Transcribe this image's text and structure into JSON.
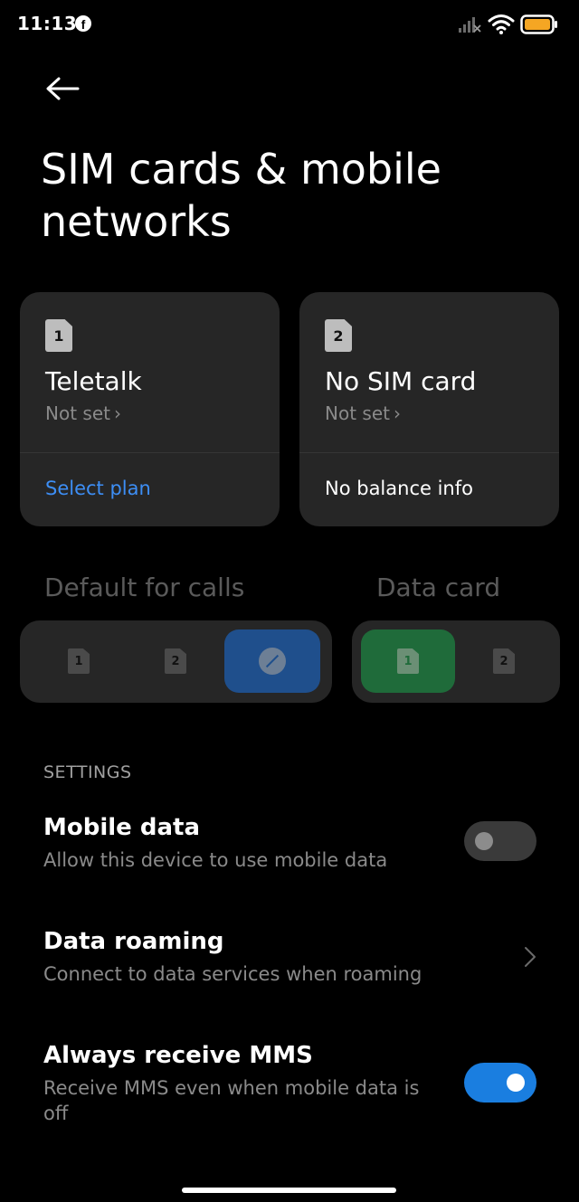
{
  "status_bar": {
    "time": "11:13",
    "notification_icon": "facebook-icon",
    "signal_icon": "cellular-signal-no-service-icon",
    "wifi_icon": "wifi-icon",
    "battery_icon": "battery-icon",
    "battery_color": "#f5a623"
  },
  "header": {
    "back_icon": "arrow-left-icon",
    "title": "SIM cards & mobile networks"
  },
  "sim_cards": [
    {
      "slot": "1",
      "name": "Teletalk",
      "status": "Not set",
      "action": "Select plan",
      "action_color": "#3d8ef5"
    },
    {
      "slot": "2",
      "name": "No SIM card",
      "status": "Not set",
      "action": "No balance info",
      "action_color": "#ffffff"
    }
  ],
  "defaults": {
    "calls_label": "Default for calls",
    "calls_options": [
      {
        "slot": "1",
        "selected": false
      },
      {
        "slot": "2",
        "selected": false
      },
      {
        "icon": "always-ask-icon",
        "selected": true
      }
    ],
    "data_label": "Data card",
    "data_options": [
      {
        "slot": "1",
        "selected": true
      },
      {
        "slot": "2",
        "selected": false
      }
    ],
    "accent_calls": "#1f4f8c",
    "accent_data": "#1f6b3a"
  },
  "settings": {
    "header": "SETTINGS",
    "items": [
      {
        "title": "Mobile data",
        "description": "Allow this device to use mobile data",
        "control": "toggle",
        "enabled": false
      },
      {
        "title": "Data roaming",
        "description": "Connect to data services when roaming",
        "control": "chevron"
      },
      {
        "title": "Always receive MMS",
        "description": "Receive MMS even when mobile data is off",
        "control": "toggle",
        "enabled": true
      }
    ],
    "toggle_on_color": "#1a7ee0"
  }
}
